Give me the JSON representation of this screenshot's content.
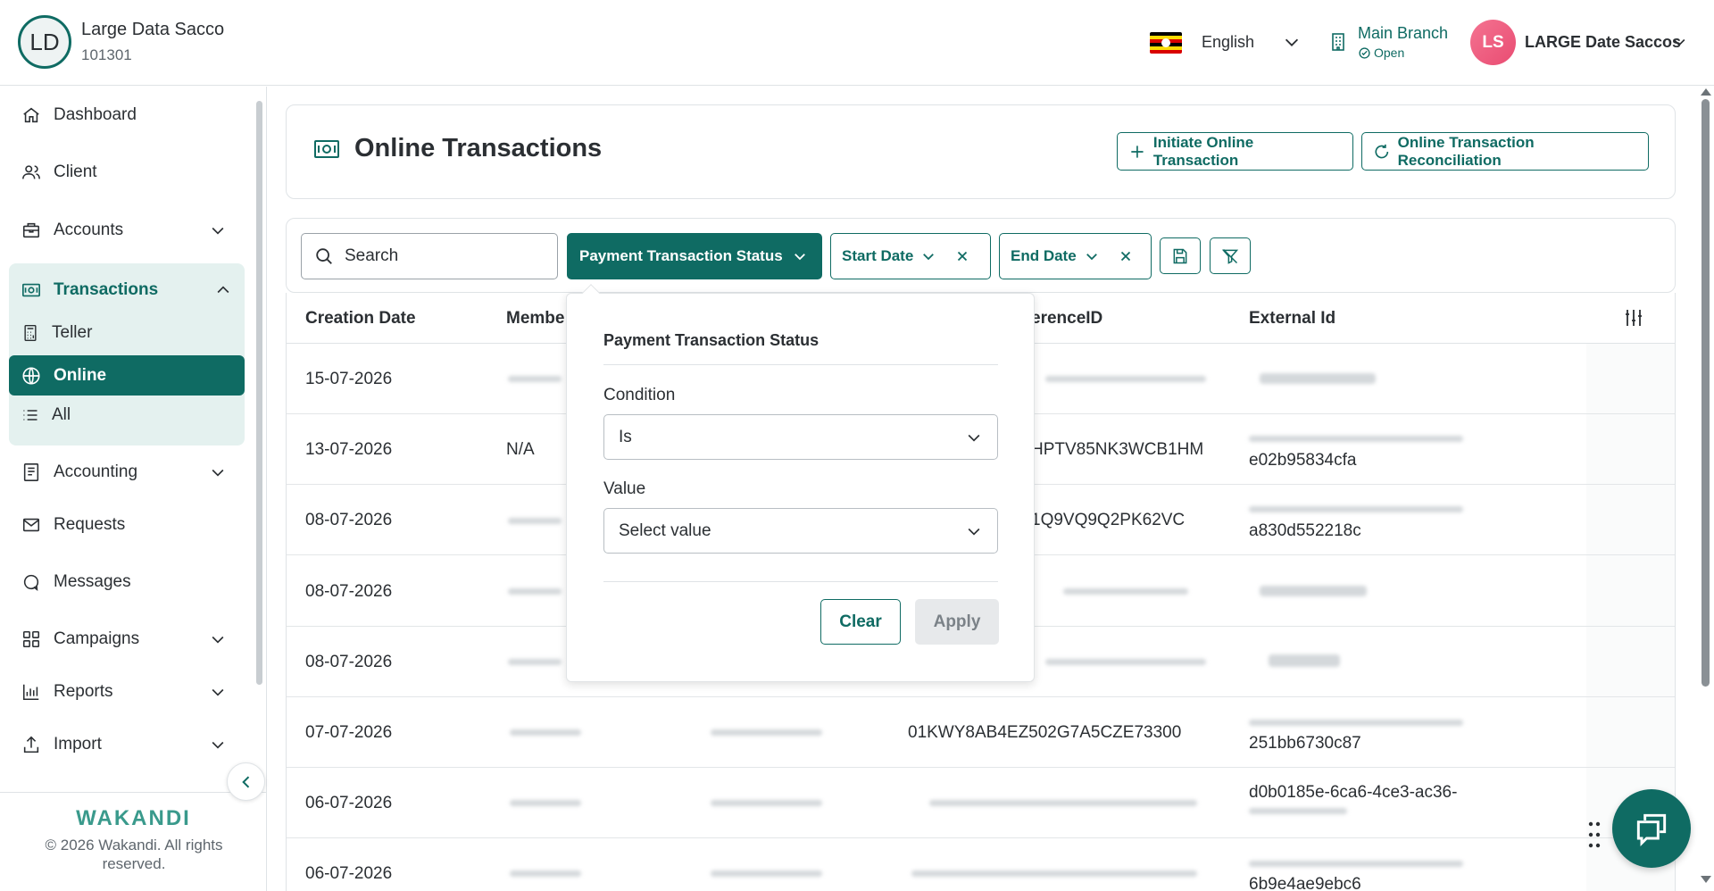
{
  "header": {
    "org_initials": "LD",
    "org_name": "Large Data Sacco",
    "org_code": "101301",
    "language": "English",
    "branch_name": "Main Branch",
    "branch_status": "Open",
    "user_initials": "LS",
    "user_name": "LARGE Date Saccos"
  },
  "sidebar": {
    "items": [
      {
        "label": "Dashboard",
        "icon": "home-icon"
      },
      {
        "label": "Client",
        "icon": "users-icon"
      },
      {
        "label": "Accounts",
        "icon": "briefcase-icon"
      },
      {
        "label": "Transactions",
        "icon": "cash-icon"
      },
      {
        "label": "Accounting",
        "icon": "ledger-icon"
      },
      {
        "label": "Requests",
        "icon": "mail-icon"
      },
      {
        "label": "Messages",
        "icon": "chat-icon"
      },
      {
        "label": "Campaigns",
        "icon": "grid-icon"
      },
      {
        "label": "Reports",
        "icon": "chart-icon"
      },
      {
        "label": "Import",
        "icon": "upload-icon"
      }
    ],
    "transaction_sub": [
      {
        "label": "Teller",
        "icon": "calculator-icon"
      },
      {
        "label": "Online",
        "icon": "globe-icon"
      },
      {
        "label": "All",
        "icon": "list-icon"
      }
    ],
    "logo": "WAKANDI",
    "copyright": "© 2026 Wakandi. All rights reserved."
  },
  "page": {
    "title": "Online Transactions",
    "initiate_label": "Initiate Online Transaction",
    "reconcile_label": "Online Transaction Reconciliation"
  },
  "filters": {
    "search_placeholder": "Search",
    "status_label": "Payment Transaction Status",
    "start_label": "Start Date",
    "end_label": "End Date"
  },
  "table": {
    "columns": [
      "Creation Date",
      "Membe",
      "erenceID",
      "External Id"
    ],
    "rows": [
      {
        "date": "15-07-2026",
        "member": "",
        "ref": "",
        "ext1": "",
        "ext2": ""
      },
      {
        "date": "13-07-2026",
        "member": "N/A",
        "ref": "HPTV85NK3WCB1HM",
        "ext1": "",
        "ext2": "e02b95834cfa"
      },
      {
        "date": "08-07-2026",
        "member": "",
        "ref": "1Q9VQ9Q2PK62VC",
        "ext1": "",
        "ext2": "a830d552218c"
      },
      {
        "date": "08-07-2026",
        "member": "",
        "ref": "",
        "ext1": "",
        "ext2": ""
      },
      {
        "date": "08-07-2026",
        "member": "",
        "ref": "",
        "ext1": "",
        "ext2": ""
      },
      {
        "date": "07-07-2026",
        "member": "",
        "ref": "01KWY8AB4EZ502G7A5CZE73300",
        "ext1": "",
        "ext2": "251bb6730c87"
      },
      {
        "date": "06-07-2026",
        "member": "",
        "ref": "",
        "ext1": "d0b0185e-6ca6-4ce3-ac36-",
        "ext2": ""
      },
      {
        "date": "06-07-2026",
        "member": "",
        "ref": "",
        "ext1": "",
        "ext2": "6b9e4ae9ebc6"
      }
    ]
  },
  "status_panel": {
    "title": "Payment Transaction Status",
    "condition_label": "Condition",
    "condition_value": "Is",
    "value_label": "Value",
    "value_placeholder": "Select value",
    "clear_label": "Clear",
    "apply_label": "Apply"
  },
  "colors": {
    "accent": "#0f6b63",
    "accent_light": "#e4f1ef",
    "avatar": "#ee5b7e"
  }
}
